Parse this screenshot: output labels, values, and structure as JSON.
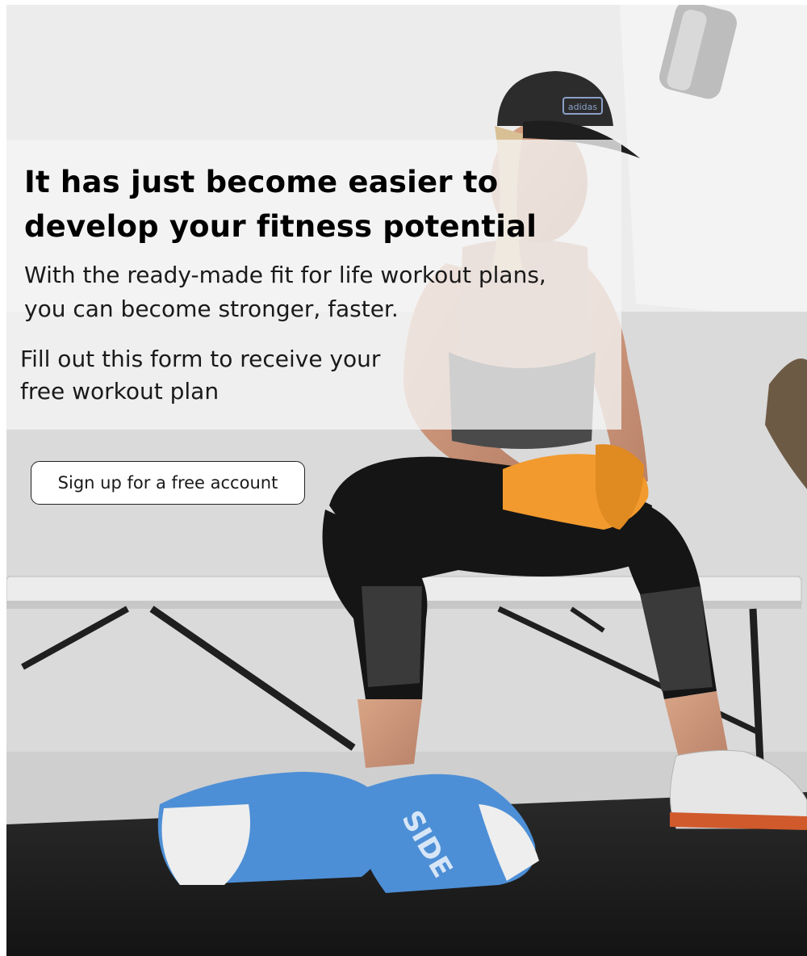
{
  "hero": {
    "headline_line1": "It has just become easier to",
    "headline_line2": "develop your fitness potential",
    "subtitle_line1": "With the ready-made fit for life workout plans,",
    "subtitle_line2": "you can become stronger, faster.",
    "form_note_line1": "Fill out this form to receive your",
    "form_note_line2": "free workout plan"
  },
  "cta": {
    "signup_label": "Sign up for a free account"
  },
  "background_image": {
    "cap_text": "adidas",
    "glove_text": "SIDE"
  },
  "colors": {
    "wrap_orange": "#f29a2e",
    "glove_blue": "#4d8fd6",
    "floor": "#1f1f1f",
    "wall": "#e4e4e4"
  }
}
